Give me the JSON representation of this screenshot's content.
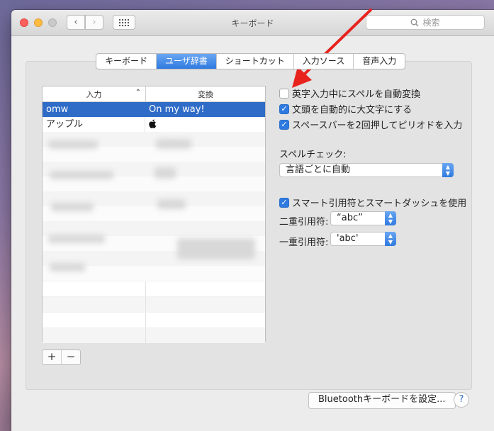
{
  "window": {
    "title": "キーボード"
  },
  "search": {
    "placeholder": "検索"
  },
  "tabs": [
    {
      "label": "キーボード",
      "active": false
    },
    {
      "label": "ユーザ辞書",
      "active": true
    },
    {
      "label": "ショートカット",
      "active": false
    },
    {
      "label": "入力ソース",
      "active": false
    },
    {
      "label": "音声入力",
      "active": false
    }
  ],
  "dictionary": {
    "col_input": "入力",
    "col_output": "変換",
    "rows": [
      {
        "input": "omw",
        "output": "On my way!",
        "selected": true
      },
      {
        "input": "アップル",
        "output": "",
        "selected": false
      }
    ]
  },
  "buttons": {
    "add": "+",
    "remove": "−",
    "bluetooth": "Bluetoothキーボードを設定...",
    "help": "?"
  },
  "options": {
    "auto_correct": {
      "label": "英字入力中にスペルを自動変換",
      "checked": false
    },
    "auto_capitalize": {
      "label": "文頭を自動的に大文字にする",
      "checked": true
    },
    "double_space_period": {
      "label": "スペースバーを2回押してピリオドを入力",
      "checked": true
    },
    "spelling_label": "スペルチェック:",
    "spelling_value": "言語ごとに自動",
    "smart_quotes": {
      "label": "スマート引用符とスマートダッシュを使用",
      "checked": true
    },
    "double_quote_label": "二重引用符:",
    "double_quote_value": "“abc”",
    "single_quote_label": "一重引用符:",
    "single_quote_value": "'abc'"
  },
  "colors": {
    "accent": "#2f7ae0",
    "selection": "#2f6cc7",
    "annotation_arrow": "#e8231e"
  }
}
